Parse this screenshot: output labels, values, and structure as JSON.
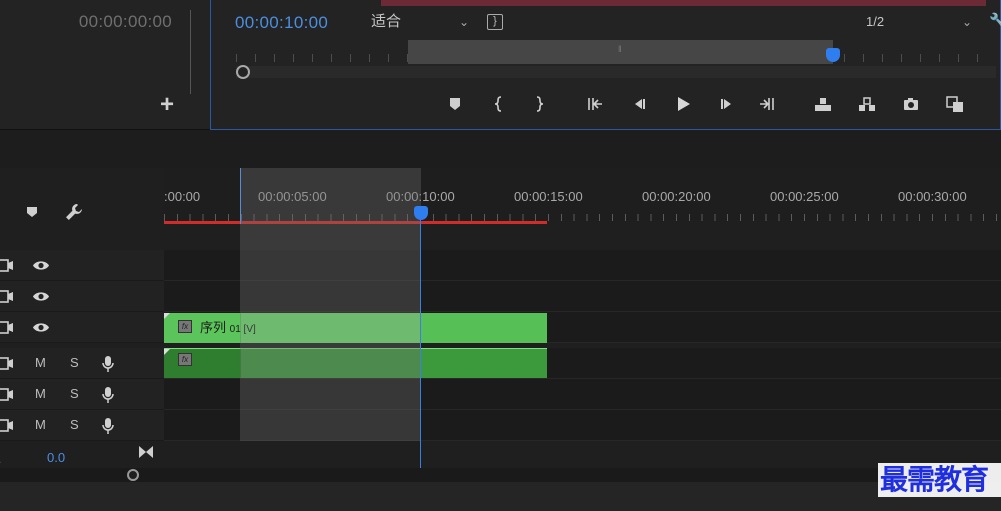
{
  "source_monitor": {
    "timecode": "00:00:00:00",
    "add_label": "+"
  },
  "program_monitor": {
    "timecode": "00:00:10:00",
    "fit_value": "适合",
    "resolution_value": "1/2",
    "transport": [
      "add-marker",
      "mark-in",
      "mark-out",
      "go-to-in",
      "step-back",
      "play",
      "step-forward",
      "go-to-out",
      "lift",
      "extract",
      "export-frame",
      "compare-view"
    ]
  },
  "timeline": {
    "ruler_labels": [
      ":00:00",
      "00:00:05:00",
      "00:00:10:00",
      "00:00:15:00",
      "00:00:20:00",
      "00:00:25:00",
      "00:00:30:00"
    ],
    "tracks": [
      {
        "type": "video",
        "m": "",
        "s": ""
      },
      {
        "type": "video",
        "m": "",
        "s": ""
      },
      {
        "type": "video",
        "m": "",
        "s": ""
      },
      {
        "type": "audio",
        "m": "M",
        "s": "S"
      },
      {
        "type": "audio",
        "m": "M",
        "s": "S"
      },
      {
        "type": "audio",
        "m": "M",
        "s": "S"
      }
    ],
    "video_clip_label": "序列",
    "video_clip_label_suffix": "01 [V]",
    "fx_label": "fx",
    "volume_value": "0.0",
    "colors": {
      "video_clip": "#6fe36f",
      "audio_clip": "#3c9a3c",
      "playhead": "#2f7ef0",
      "work_area": "#d32a2a",
      "timecode_active": "#4a8fe2"
    }
  },
  "watermark": "最需教育"
}
